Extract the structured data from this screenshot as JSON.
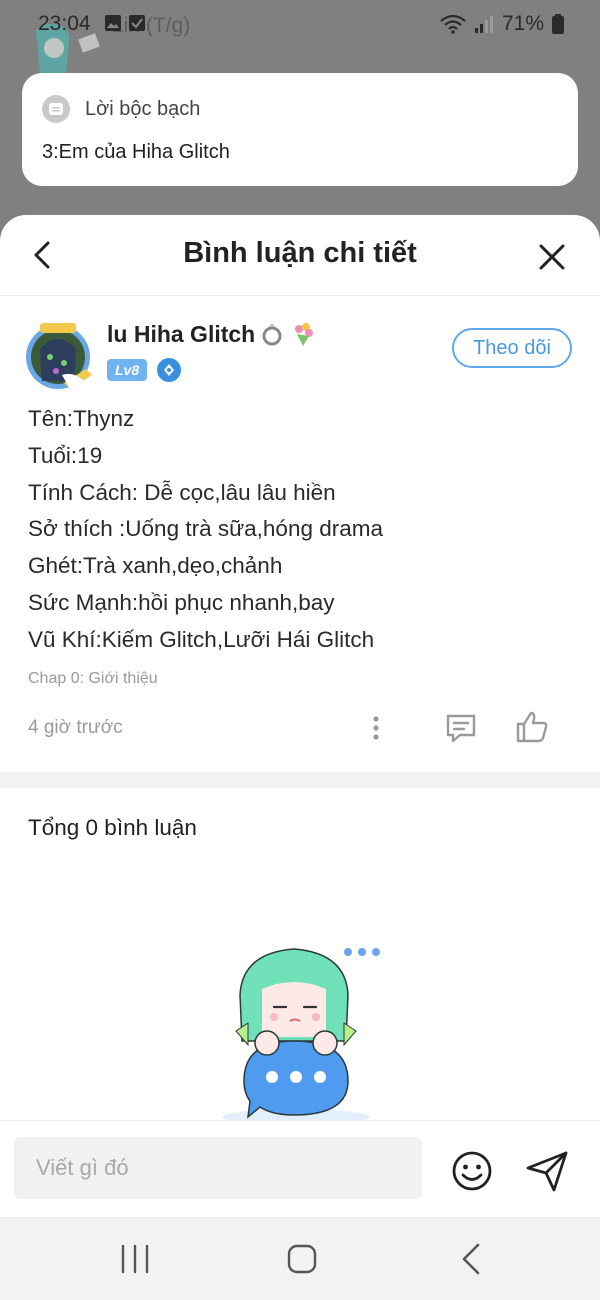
{
  "status_bar": {
    "time": "23:04",
    "battery": "71%"
  },
  "background": {
    "title": "Lin (T/g)"
  },
  "notification": {
    "title": "Lời bộc bạch",
    "body": "3:Em của Hiha Glitch"
  },
  "sheet": {
    "title": "Bình luận chi tiết"
  },
  "post": {
    "author": "lu Hiha Glitch",
    "level": "Lv8",
    "follow_label": "Theo dõi",
    "lines": [
      "Tên:Thynz",
      "Tuổi:19",
      "Tính Cách: Dễ cọc,lâu lâu hiền",
      "Sở thích :Uống trà sữa,hóng drama",
      "Ghét:Trà xanh,dẹo,chảnh",
      "Sức Mạnh:hồi phục nhanh,bay",
      "Vũ Khí:Kiếm Glitch,Lưỡi Hái Glitch"
    ],
    "chapter": "Chap 0: Giới thiệu",
    "time_ago": "4 giờ trước"
  },
  "comments": {
    "total_label": "Tổng 0 bình luận"
  },
  "input": {
    "placeholder": "Viết gì đó"
  },
  "colors": {
    "accent": "#4a98e4",
    "badge": "#6fb4ef",
    "mascot_hair": "#6fe0b8",
    "bubble": "#4f9bf0"
  }
}
